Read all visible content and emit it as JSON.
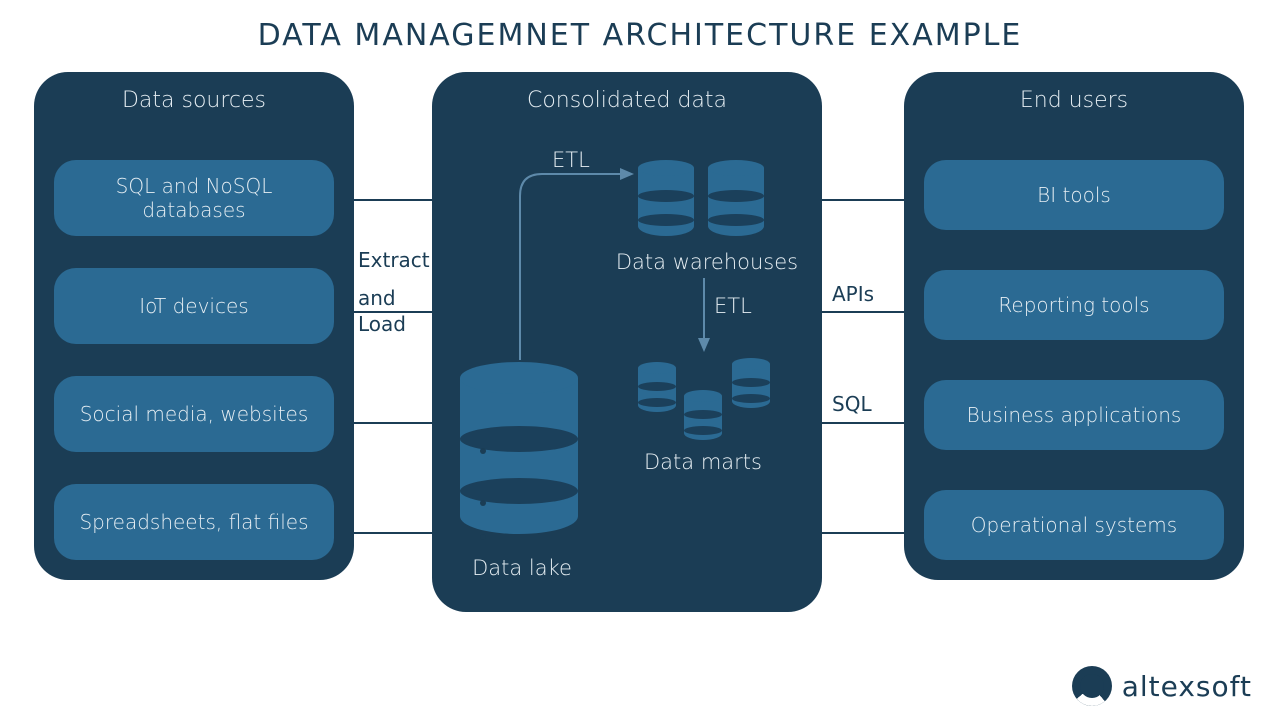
{
  "title": "DATA MANAGEMNET ARCHITECTURE EXAMPLE",
  "panels": {
    "left": {
      "header": "Data sources",
      "items": [
        "SQL and NoSQL databases",
        "IoT devices",
        "Social media, websites",
        "Spreadsheets, flat files"
      ]
    },
    "middle": {
      "header": "Consolidated data",
      "labels": {
        "etl_up": "ETL",
        "etl_down": "ETL",
        "datalake": "Data lake",
        "warehouses": "Data warehouses",
        "marts": "Data marts"
      }
    },
    "right": {
      "header": "End users",
      "items": [
        "BI tools",
        "Reporting tools",
        "Business applications",
        "Operational systems"
      ]
    }
  },
  "connectors": {
    "left_to_mid": {
      "line1": "Extract",
      "line2": "and",
      "line3": "Load"
    },
    "mid_to_right": {
      "line1": "APIs",
      "line2": "SQL"
    }
  },
  "brand": "altexsoft",
  "colors": {
    "panel": "#1b3d55",
    "block": "#2b6a93",
    "text_light": "#e6eef3"
  }
}
